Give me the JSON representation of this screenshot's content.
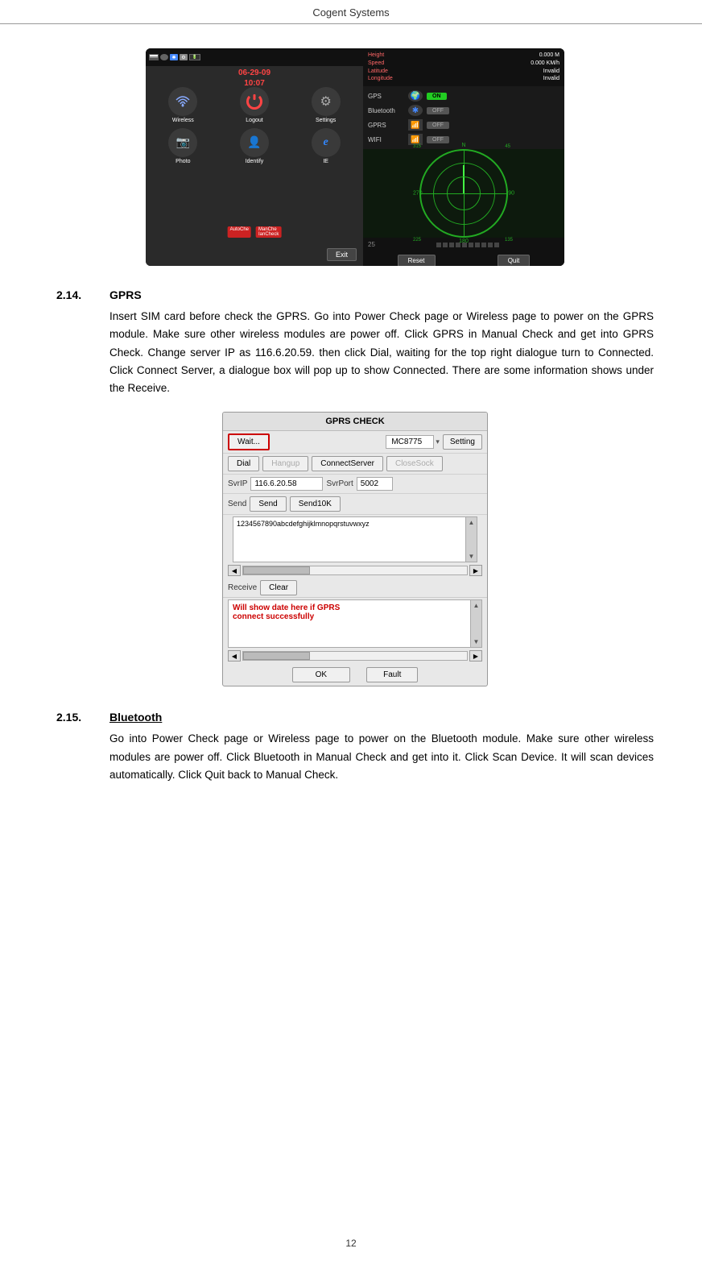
{
  "header": {
    "title": "Cogent Systems"
  },
  "device_screenshot": {
    "date": "06-29-09",
    "time": "10:07",
    "icons": [
      {
        "label": "Wireless",
        "icon": "wireless"
      },
      {
        "label": "Logout",
        "icon": "logout"
      },
      {
        "label": "Settings",
        "icon": "gear"
      },
      {
        "label": "Photo",
        "icon": "photo"
      },
      {
        "label": "Identify",
        "icon": "identify"
      },
      {
        "label": "IE",
        "icon": "ie"
      }
    ],
    "gps_toggles": [
      {
        "label": "GPS",
        "state": "ON"
      },
      {
        "label": "Bluetooth",
        "state": "OFF"
      },
      {
        "label": "GPRS",
        "state": "OFF"
      },
      {
        "label": "WIFI",
        "state": "OFF"
      }
    ],
    "gps_info": {
      "labels": [
        "Height",
        "Speed",
        "Latitude",
        "Longitude"
      ],
      "values": [
        "0.000 M",
        "0.000 KM/h",
        "Invalid",
        "Invalid"
      ]
    },
    "radar_labels": {
      "north": "N",
      "south": "180",
      "east": "90",
      "west": "270",
      "ne": "45",
      "nw": "315",
      "se": "135",
      "sw": "225"
    },
    "bottom_buttons": [
      "Reset",
      "Quit"
    ],
    "exit_btn": "Exit"
  },
  "sections": [
    {
      "number": "2.14.",
      "title": "GPRS",
      "underline": false,
      "body": "Insert SIM card before check the GPRS. Go into Power Check page or Wireless page to power on the GPRS module. Make sure other wireless modules are power off. Click GPRS in Manual Check and get into GPRS Check. Change server IP as 116.6.20.59. then click Dial, waiting for the top right dialogue turn to Connected. Click Connect Server, a dialogue box will pop up to show Connected. There are some information shows under the Receive."
    },
    {
      "number": "2.15.",
      "title": "Bluetooth",
      "underline": true,
      "body": "Go into Power Check page or Wireless page to power on the Bluetooth module. Make sure other wireless modules are power off. Click Bluetooth in Manual Check and get into it. Click Scan Device. It will scan devices automatically. Click Quit back to Manual Check."
    }
  ],
  "gprs_dialog": {
    "title": "GPRS CHECK",
    "wait_btn": "Wait...",
    "module_value": "MC8775",
    "setting_btn": "Setting",
    "dial_btn": "Dial",
    "hangup_btn": "Hangup",
    "connect_server_btn": "ConnectServer",
    "close_sock_btn": "CloseSock",
    "svr_ip_label": "SvrIP",
    "svr_ip_value": "116.6.20.58",
    "svr_port_label": "SvrPort",
    "svr_port_value": "5002",
    "send_label": "Send",
    "send_btn": "Send",
    "send10k_btn": "Send10K",
    "textarea_content": "1234567890abcdefghijklmnopqrstuvwxyz",
    "receive_label": "Receive",
    "clear_btn": "Clear",
    "receive_text_line1": "Will show date here if GPRS",
    "receive_text_line2": "connect successfully",
    "ok_btn": "OK",
    "fault_btn": "Fault"
  },
  "page_number": "12"
}
